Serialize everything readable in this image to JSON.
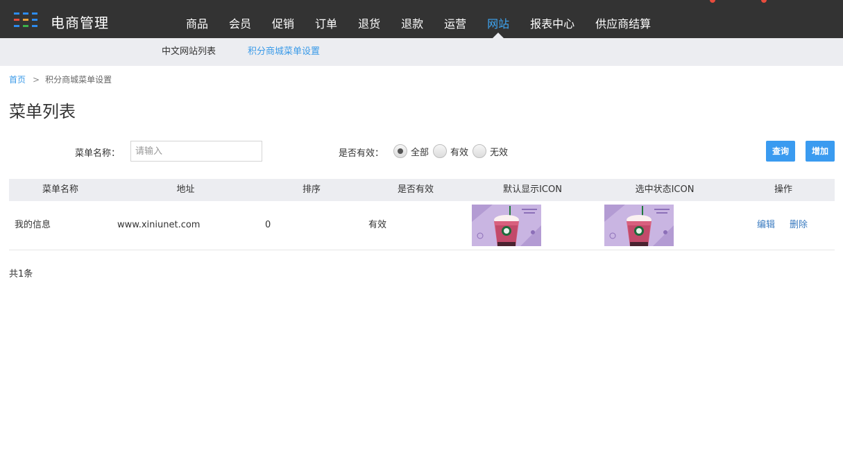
{
  "app": {
    "title": "电商管理",
    "logo_colors": [
      "#2d8cf0",
      "#2d8cf0",
      "#e84c3d",
      "#2d8cf0",
      "#e8a33d",
      "#2d8cf0",
      "#3cb44b",
      "#2d8cf0",
      "#2d8cf0"
    ]
  },
  "nav": {
    "items": [
      {
        "label": "商品"
      },
      {
        "label": "会员"
      },
      {
        "label": "促销"
      },
      {
        "label": "订单"
      },
      {
        "label": "退货"
      },
      {
        "label": "退款"
      },
      {
        "label": "运营"
      },
      {
        "label": "网站",
        "active": true
      },
      {
        "label": "报表中心"
      },
      {
        "label": "供应商结算"
      }
    ],
    "active_color": "#3ea7f5"
  },
  "subnav": {
    "items": [
      {
        "label": "中文网站列表"
      },
      {
        "label": "积分商城菜单设置",
        "active": true
      }
    ]
  },
  "breadcrumb": {
    "home": "首页",
    "separator": ">",
    "current": "积分商城菜单设置"
  },
  "page": {
    "title": "菜单列表"
  },
  "filter": {
    "name_label": "菜单名称：",
    "name_placeholder": "请输入",
    "name_value": "",
    "valid_label": "是否有效：",
    "valid_options": [
      {
        "label": "全部",
        "checked": true
      },
      {
        "label": "有效",
        "checked": false
      },
      {
        "label": "无效",
        "checked": false
      }
    ],
    "query_button": "查询",
    "add_button": "增加"
  },
  "table": {
    "headers": [
      "菜单名称",
      "地址",
      "排序",
      "是否有效",
      "默认显示ICON",
      "选中状态ICON",
      "操作"
    ],
    "rows": [
      {
        "name": "我的信息",
        "url": "www.xiniunet.com",
        "sort": "0",
        "valid": "有效",
        "default_icon": "starbucks-drink-thumbnail",
        "selected_icon": "starbucks-drink-thumbnail",
        "actions": [
          "编辑",
          "删除"
        ]
      }
    ]
  },
  "footer": {
    "total": "共1条"
  }
}
